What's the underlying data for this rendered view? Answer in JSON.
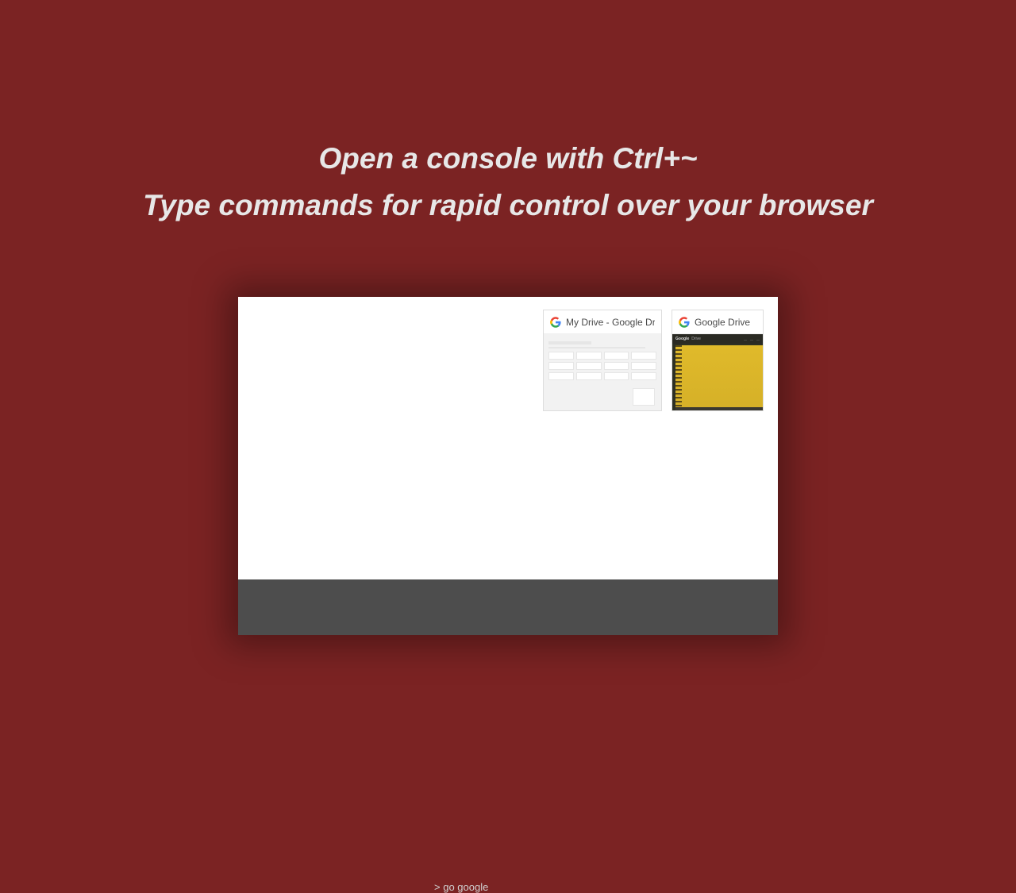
{
  "headline": {
    "line1": "Open a console with Ctrl+~",
    "line2": "Type commands for rapid control over your browser"
  },
  "thumbs": [
    {
      "title": "My Drive - Google Driv"
    },
    {
      "title": "Google Drive"
    }
  ],
  "thumb2_photo": {
    "logo": "Google",
    "product": "Drive"
  },
  "console": {
    "prompt": ">",
    "command": "go google"
  }
}
